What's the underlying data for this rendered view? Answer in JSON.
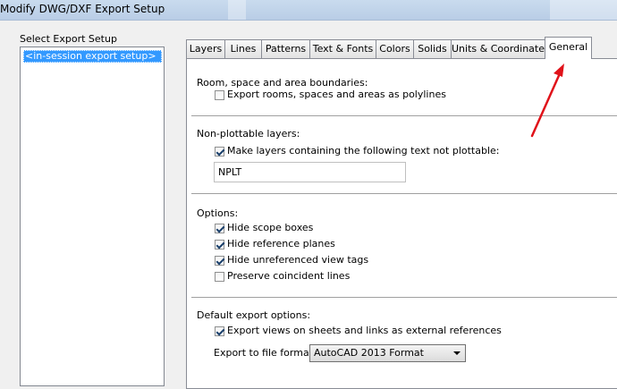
{
  "window": {
    "title": "Modify DWG/DXF Export Setup"
  },
  "setup_list": {
    "label": "Select Export Setup",
    "items": [
      "<in-session export setup>"
    ]
  },
  "tabs": [
    "Layers",
    "Lines",
    "Patterns",
    "Text & Fonts",
    "Colors",
    "Solids",
    "Units & Coordinates",
    "General"
  ],
  "active_tab": "General",
  "general": {
    "room_section": {
      "heading": "Room, space and area boundaries:",
      "export_polylines": {
        "label": "Export rooms, spaces and areas as polylines",
        "checked": false
      }
    },
    "nonplot_section": {
      "heading": "Non-plottable layers:",
      "make_nonplottable": {
        "label": "Make layers containing the following text not plottable:",
        "checked": true
      },
      "text_value": "NPLT"
    },
    "options_section": {
      "heading": "Options:",
      "hide_scope_boxes": {
        "label": "Hide scope boxes",
        "checked": true
      },
      "hide_reference_planes": {
        "label": "Hide reference planes",
        "checked": true
      },
      "hide_unreferenced_tags": {
        "label": "Hide unreferenced view tags",
        "checked": true
      },
      "preserve_coincident": {
        "label": "Preserve coincident lines",
        "checked": false
      }
    },
    "default_section": {
      "heading": "Default export options:",
      "export_views": {
        "label": "Export views on sheets and links as external references",
        "checked": true
      },
      "format_label": "Export to file format:",
      "format_value": "AutoCAD 2013 Format"
    }
  },
  "colors": {
    "selection": "#3399ff",
    "annotation_arrow": "#e0121a"
  }
}
